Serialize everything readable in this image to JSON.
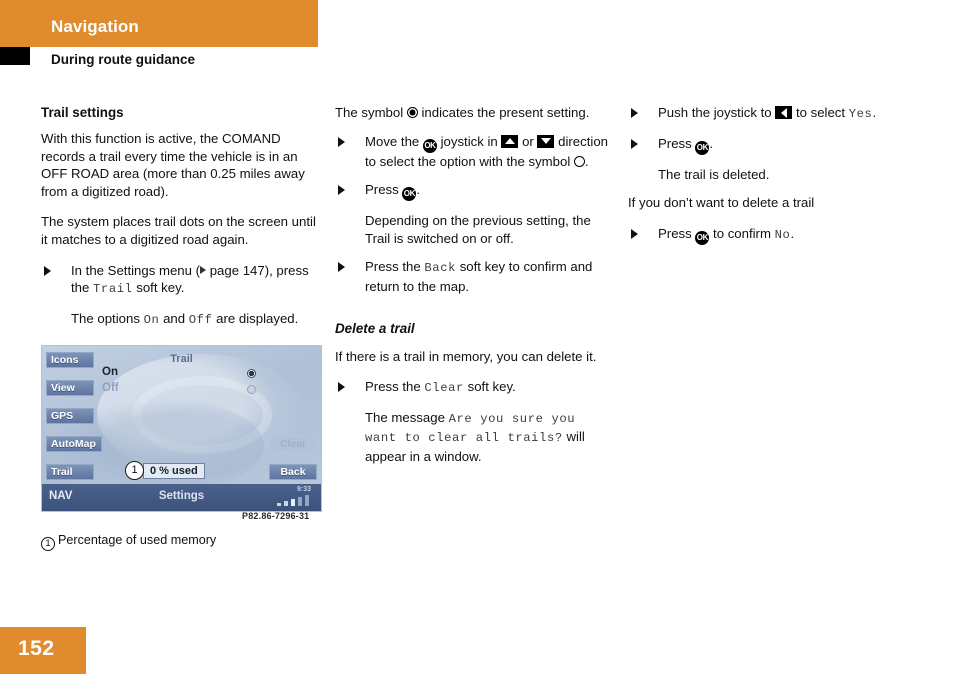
{
  "header": {
    "chapter_title": "Navigation",
    "section_title": "During route guidance",
    "accent_color": "#e08b2e"
  },
  "footer": {
    "page_number": "152"
  },
  "column1": {
    "heading": "Trail settings",
    "para1": "With this function is active, the COMAND records a trail every time the vehicle is in an OFF ROAD area (more than 0.25 miles away from a digitized road).",
    "para2": "The system places trail dots on the screen until it matches to a digitized road again.",
    "bullet1_pre": "In the Settings menu (",
    "bullet1_ref": " page 147), press the ",
    "bullet1_code": "Trail",
    "bullet1_post": " soft key.",
    "sub1_pre": "The options ",
    "sub1_code_on": "On",
    "sub1_mid": " and ",
    "sub1_code_off": "Off",
    "sub1_post": " are displayed."
  },
  "figure": {
    "title": "Trail",
    "option_on": "On",
    "option_off": "Off",
    "softkeys_left": [
      "Icons",
      "View",
      "GPS",
      "AutoMap",
      "Trail"
    ],
    "softkey_clear": "Clear",
    "softkey_back": "Back",
    "callout_number": "1",
    "memory_used": "0 % used",
    "status_left": "NAV",
    "status_center": "Settings",
    "status_clock": "9:33",
    "image_code": "P82.86-7296-31",
    "caption_number": "1",
    "caption_text": "Percentage of used memory"
  },
  "column2": {
    "para1_pre": "The symbol ",
    "para1_post": " indicates the present setting.",
    "bullet1_a": "Move the ",
    "bullet1_b": " joystick in ",
    "bullet1_c": " or ",
    "bullet1_d": " direction to select the option with the symbol ",
    "bullet1_e": ".",
    "bullet2_pre": "Press ",
    "bullet2_post": ".",
    "sub2": "Depending on the previous setting, the Trail is switched on or off.",
    "bullet3_pre": "Press the ",
    "bullet3_code": "Back",
    "bullet3_post": " soft key to confirm and return to the map.",
    "heading2": "Delete a trail",
    "para2": "If there is a trail in memory, you can delete it.",
    "bullet4_pre": "Press the ",
    "bullet4_code": "Clear",
    "bullet4_post": " soft key.",
    "sub4_pre": "The message ",
    "sub4_code": "Are you sure you want to clear all trails?",
    "sub4_post": " will appear in a window."
  },
  "column3": {
    "bullet1_a": "Push the joystick to ",
    "bullet1_b": " to select ",
    "bullet1_code": "Yes",
    "bullet1_c": ".",
    "bullet2_pre": "Press ",
    "bullet2_post": ".",
    "sub2": "The trail is deleted.",
    "para1": "If you don’t want to delete a trail",
    "bullet3_pre": "Press ",
    "bullet3_mid": " to confirm ",
    "bullet3_code": "No",
    "bullet3_post": "."
  },
  "glyphs": {
    "ok_button": "OK",
    "arrow_up": "up-arrow",
    "arrow_down": "down-arrow",
    "arrow_left": "left-arrow"
  }
}
